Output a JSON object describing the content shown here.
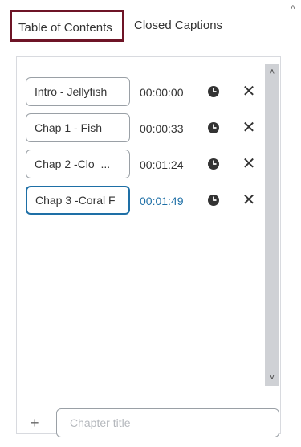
{
  "tabs": [
    {
      "label": "Table of Contents",
      "selected": true
    },
    {
      "label": "Closed Captions",
      "selected": false
    }
  ],
  "chapters": [
    {
      "title": "Intro - Jellyfish",
      "time": "00:00:00"
    },
    {
      "title": "Chap 1 - Fish",
      "time": "00:00:33"
    },
    {
      "title": "Chap 2 -Clo  ...",
      "time": "00:01:24"
    },
    {
      "title": "Chap 3 -Coral F",
      "time": "00:01:49",
      "active": true
    }
  ],
  "add_chapter": {
    "placeholder": "Chapter title",
    "plus": "+"
  },
  "icons": {
    "clock": "clock-icon",
    "remove": "close-icon",
    "remove_glyph": "✕",
    "up": "˄",
    "down": "˅"
  },
  "colors": {
    "selected_tab_border": "#6e1426",
    "active_accent": "#1e6fa6"
  }
}
